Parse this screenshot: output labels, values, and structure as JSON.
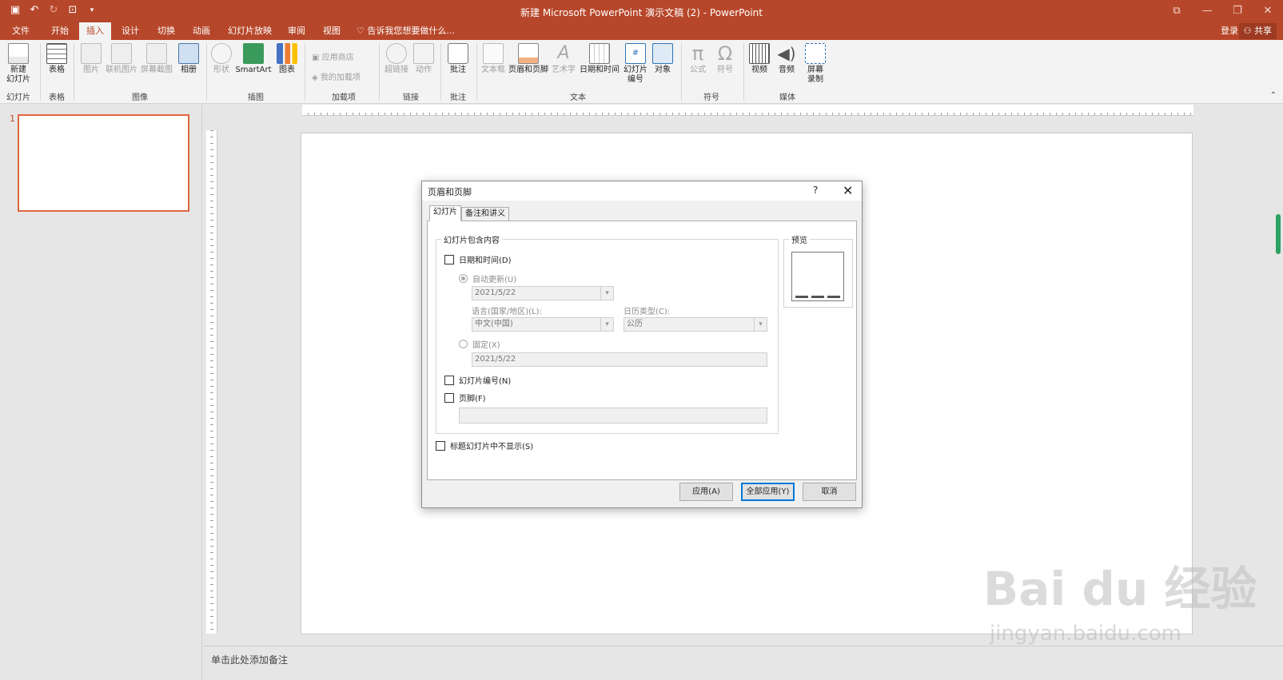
{
  "window": {
    "title": "新建 Microsoft PowerPoint 演示文稿 (2) - PowerPoint",
    "login": "登录",
    "share": "共享"
  },
  "colors": {
    "accent": "#b7472a",
    "selection": "#e0663e",
    "primary_button": "#0078d7"
  },
  "tabs": [
    "文件",
    "开始",
    "插入",
    "设计",
    "切换",
    "动画",
    "幻灯片放映",
    "审阅",
    "视图"
  ],
  "tell_me": "告诉我您想要做什么...",
  "ribbon": {
    "new_slide": "新建\n幻灯片",
    "table": "表格",
    "picture": "图片",
    "online_picture": "联机图片",
    "screenshot": "屏幕截图",
    "album": "相册",
    "shapes": "形状",
    "smartart": "SmartArt",
    "chart": "图表",
    "store": "应用商店",
    "my_addins": "我的加载项",
    "hyperlink": "超链接",
    "action": "动作",
    "comment": "批注",
    "textbox": "文本框",
    "header_footer": "页眉和页脚",
    "wordart": "艺术字",
    "datetime": "日期和时间",
    "slide_number": "幻灯片\n编号",
    "object": "对象",
    "equation": "公式",
    "symbol": "符号",
    "video": "视频",
    "audio": "音频",
    "screen_record": "屏幕\n录制",
    "groups": {
      "slides": "幻灯片",
      "tables": "表格",
      "images": "图像",
      "illustrations": "插图",
      "addins": "加载项",
      "links": "链接",
      "comments": "批注",
      "text": "文本",
      "symbols": "符号",
      "media": "媒体"
    }
  },
  "slide_panel": {
    "number": "1"
  },
  "notes": "单击此处添加备注",
  "dialog": {
    "title": "页眉和页脚",
    "help": "?",
    "tabs": [
      "幻灯片",
      "备注和讲义"
    ],
    "group_label": "幻灯片包含内容",
    "preview_label": "预览",
    "date_time": "日期和时间(D)",
    "auto_update": "自动更新(U)",
    "auto_date_value": "2021/5/22",
    "language_label": "语言(国家/地区)(L):",
    "language_value": "中文(中国)",
    "calendar_label": "日历类型(C):",
    "calendar_value": "公历",
    "fixed": "固定(X)",
    "fixed_value": "2021/5/22",
    "slide_number": "幻灯片编号(N)",
    "footer": "页脚(F)",
    "footer_value": "",
    "hide_on_title": "标题幻灯片中不显示(S)",
    "apply": "应用(A)",
    "apply_all": "全部应用(Y)",
    "cancel": "取消"
  },
  "watermark": {
    "brand": "Bai du 经验",
    "url": "jingyan.baidu.com"
  }
}
